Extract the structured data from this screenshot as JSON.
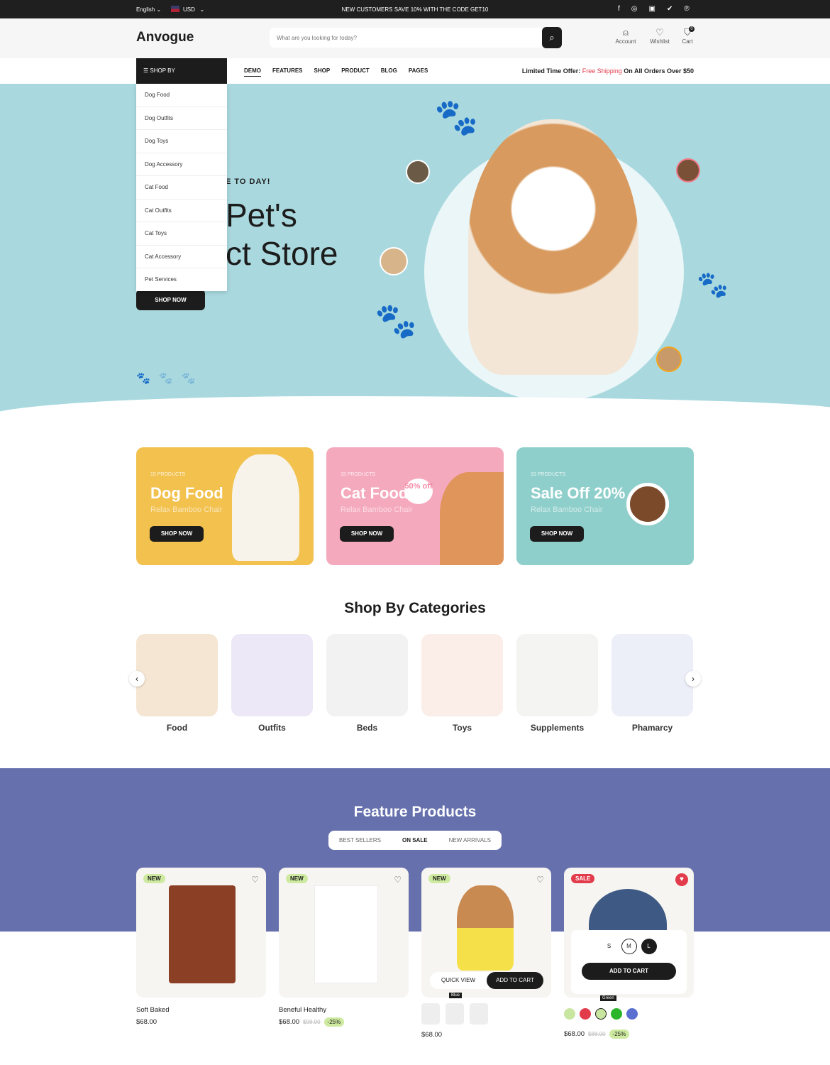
{
  "topbar": {
    "language": "English",
    "currency": "USD",
    "announcement": "NEW CUSTOMERS SAVE 10% WITH THE CODE GET10",
    "social": [
      "facebook-icon",
      "instagram-icon",
      "youtube-icon",
      "twitter-icon",
      "pinterest-icon"
    ]
  },
  "header": {
    "logo": "Anvogue",
    "search_placeholder": "What are you looking for today?",
    "account": "Account",
    "wishlist": "Wishlist",
    "cart": "Cart",
    "cart_count": "0"
  },
  "nav": {
    "shop_by": "SHOP BY",
    "items": [
      "DEMO",
      "FEATURES",
      "SHOP",
      "PRODUCT",
      "BLOG",
      "PAGES"
    ],
    "offer_prefix": "Limited Time Offer: ",
    "offer_highlight": "Free Shipping",
    "offer_suffix": " On All Orders Over $50"
  },
  "dropdown": [
    "Dog Food",
    "Dog Outfits",
    "Dog Toys",
    "Dog Accessory",
    "Cat Food",
    "Cat Outfits",
    "Cat Toys",
    "Cat Accessory",
    "Pet Services"
  ],
  "hero": {
    "kicker": "E TO DAY!",
    "line1": "Pet's",
    "line2": "ct Store",
    "button": "SHOP NOW"
  },
  "promos": [
    {
      "count": "15 PRODUCTS",
      "title": "Dog Food",
      "subtitle": "Relax Bamboo Chair",
      "button": "SHOP NOW",
      "color": "#f2c14e"
    },
    {
      "count": "15 PRODUCTS",
      "title": "Cat Food",
      "subtitle": "Relax Bamboo Chair",
      "button": "SHOP NOW",
      "color": "#f5a9bd",
      "sticker": "50% off"
    },
    {
      "count": "15 PRODUCTS",
      "title": "Sale Off 20%",
      "subtitle": "Relax Bamboo Chair",
      "button": "SHOP NOW",
      "color": "#8fcfcb"
    }
  ],
  "categories": {
    "title": "Shop By Categories",
    "items": [
      "Food",
      "Outfits",
      "Beds",
      "Toys",
      "Supplements",
      "Phamarcy"
    ]
  },
  "featured": {
    "title": "Feature Products",
    "tabs": [
      "BEST SELLERS",
      "ON SALE",
      "NEW ARRIVALS"
    ],
    "active_tab": "ON SALE",
    "products": [
      {
        "badge": "NEW",
        "name": "Soft Baked",
        "price": "$68.00"
      },
      {
        "badge": "NEW",
        "name": "Beneful Healthy",
        "price": "$68.00",
        "old_price": "$98.00",
        "discount": "-25%"
      },
      {
        "badge": "NEW",
        "name": "",
        "price": "$68.00",
        "quick_view": "QUICK VIEW",
        "add_to_cart": "ADD TO CART",
        "tooltip": "Blue"
      },
      {
        "badge": "SALE",
        "name": "",
        "price": "$68.00",
        "old_price": "$88.00",
        "discount": "-25%",
        "sizes": [
          "S",
          "M",
          "L"
        ],
        "add_to_cart": "ADD TO CART",
        "tooltip": "Green"
      }
    ]
  }
}
